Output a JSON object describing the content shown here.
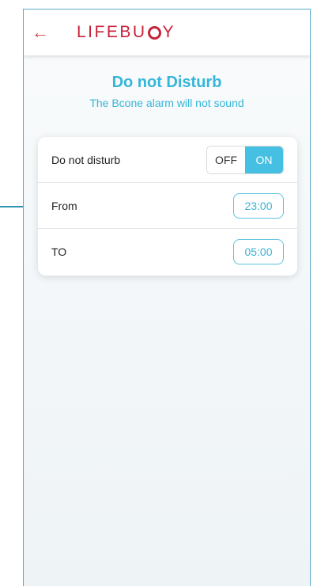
{
  "header": {
    "back_icon": "←",
    "brand_prefix": "LIFEBU",
    "brand_suffix": "Y"
  },
  "page": {
    "title": "Do not Disturb",
    "subtitle": "The Bcone alarm will not sound"
  },
  "settings": {
    "dnd_label": "Do not disturb",
    "toggle_off": "OFF",
    "toggle_on": "ON",
    "toggle_state": "ON",
    "from_label": "From",
    "from_value": "23:00",
    "to_label": "TO",
    "to_value": "05:00"
  },
  "colors": {
    "accent": "#45bfe2",
    "brand": "#c8223a",
    "callout": "#2f93b1"
  }
}
